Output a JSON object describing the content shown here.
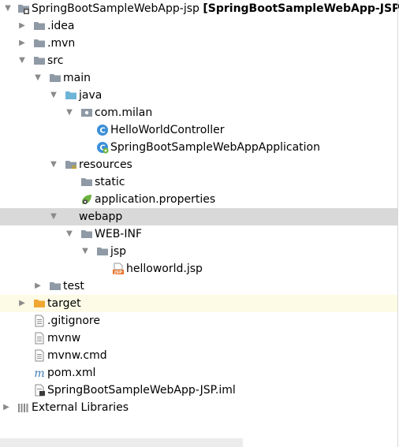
{
  "tree": {
    "items": [
      {
        "name": "SpringBootSampleWebApp-jsp",
        "bracket": "[SpringBootSampleWebApp-JSP]",
        "icon": "module-icon",
        "expanded": true
      },
      {
        "name": ".idea",
        "icon": "folder-icon",
        "expanded": false
      },
      {
        "name": ".mvn",
        "icon": "folder-icon",
        "expanded": false
      },
      {
        "name": "src",
        "icon": "folder-icon",
        "expanded": true
      },
      {
        "name": "main",
        "icon": "folder-icon",
        "expanded": true
      },
      {
        "name": "java",
        "icon": "source-folder-icon",
        "expanded": true
      },
      {
        "name": "com.milan",
        "icon": "package-icon",
        "expanded": true
      },
      {
        "name": "HelloWorldController",
        "icon": "java-class-icon"
      },
      {
        "name": "SpringBootSampleWebAppApplication",
        "icon": "spring-boot-class-icon"
      },
      {
        "name": "resources",
        "icon": "resources-folder-icon",
        "expanded": true
      },
      {
        "name": "static",
        "icon": "folder-icon"
      },
      {
        "name": "application.properties",
        "icon": "spring-properties-icon"
      },
      {
        "name": "webapp",
        "icon": "web-folder-icon",
        "expanded": true
      },
      {
        "name": "WEB-INF",
        "icon": "folder-icon",
        "expanded": true
      },
      {
        "name": "jsp",
        "icon": "folder-icon",
        "expanded": true
      },
      {
        "name": "helloworld.jsp",
        "icon": "jsp-file-icon",
        "badge": "JSP"
      },
      {
        "name": "test",
        "icon": "folder-icon",
        "expanded": false
      },
      {
        "name": "target",
        "icon": "excluded-folder-icon",
        "expanded": false
      },
      {
        "name": ".gitignore",
        "icon": "text-file-icon"
      },
      {
        "name": "mvnw",
        "icon": "text-file-icon"
      },
      {
        "name": "mvnw.cmd",
        "icon": "text-file-icon"
      },
      {
        "name": "pom.xml",
        "icon": "maven-icon",
        "glyph": "m"
      },
      {
        "name": "SpringBootSampleWebApp-JSP.iml",
        "icon": "iml-file-icon"
      },
      {
        "name": "External Libraries",
        "icon": "libraries-icon",
        "expanded": false
      }
    ]
  },
  "colors": {
    "selected_row": "#d9d9d9",
    "highlight_row": "#fdfbe6",
    "folder": "#8f9aa6",
    "source_folder": "#6fb4d8",
    "excluded_folder": "#f0a732",
    "java_class": "#3b8fd8",
    "spring": "#6db33f",
    "maven": "#3e7bb6",
    "jsp": "#e8742a"
  }
}
